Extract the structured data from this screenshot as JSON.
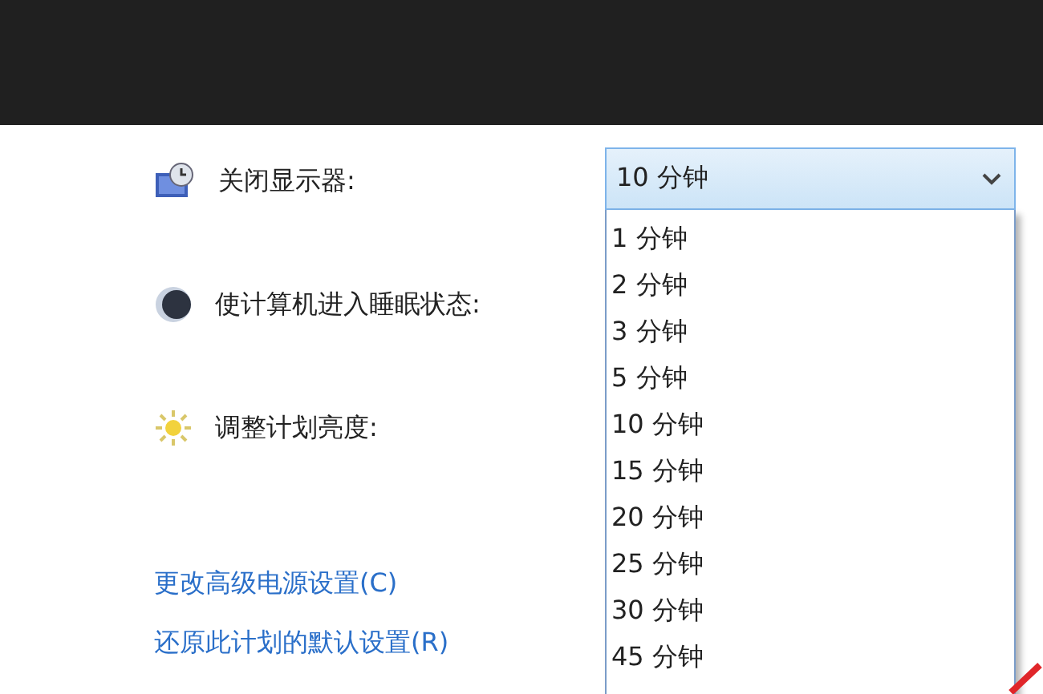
{
  "settings": [
    {
      "kind": "display",
      "label": "关闭显示器:"
    },
    {
      "kind": "sleep",
      "label": "使计算机进入睡眠状态:"
    },
    {
      "kind": "brightness",
      "label": "调整计划亮度:"
    }
  ],
  "combo": {
    "value": "10 分钟",
    "expanded": true,
    "options": [
      "1 分钟",
      "2 分钟",
      "3 分钟",
      "5 分钟",
      "10 分钟",
      "15 分钟",
      "20 分钟",
      "25 分钟",
      "30 分钟",
      "45 分钟"
    ]
  },
  "links": [
    "更改高级电源设置(C)",
    "还原此计划的默认设置(R)"
  ]
}
